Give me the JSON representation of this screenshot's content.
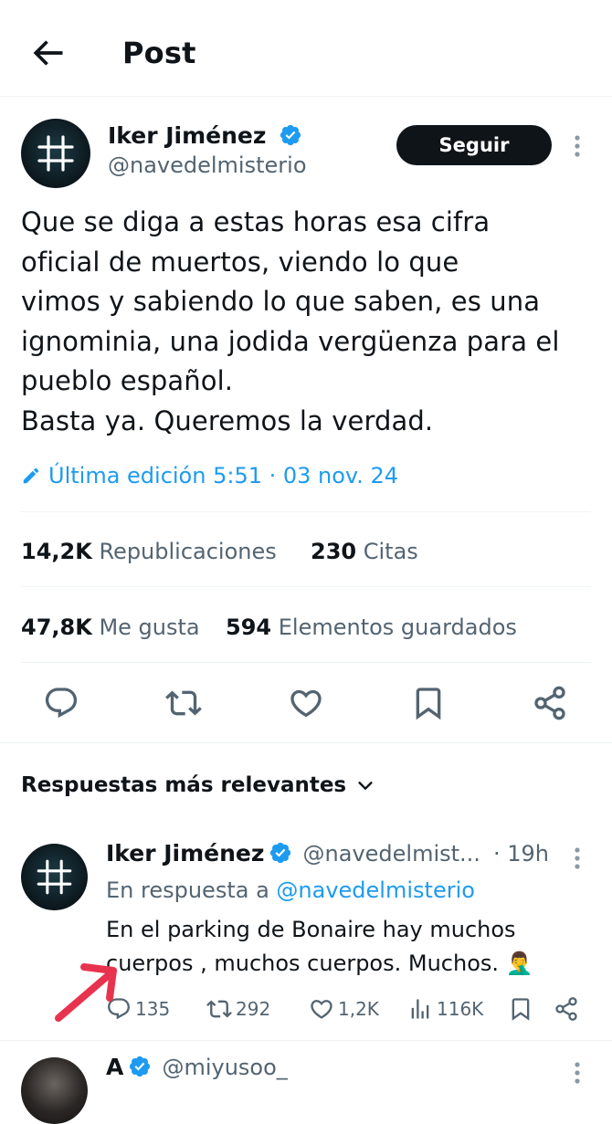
{
  "header": {
    "title": "Post"
  },
  "post": {
    "author_name": "Iker Jiménez",
    "author_handle": "@navedelmisterio",
    "follow_label": "Seguir",
    "text_lines": [
      "Que se diga a estas horas esa cifra",
      "oficial de muertos, viendo lo que",
      "vimos y sabiendo lo que saben, es una",
      "ignominia, una jodida vergüenza para el",
      "pueblo español.",
      "Basta ya. Queremos la verdad."
    ],
    "edited_label": "Última edición 5:51 · 03 nov. 24",
    "stats": {
      "reposts_count": "14,2K",
      "reposts_label": "Republicaciones",
      "quotes_count": "230",
      "quotes_label": "Citas",
      "likes_count": "47,8K",
      "likes_label": "Me gusta",
      "bookmarks_count": "594",
      "bookmarks_label": "Elementos guardados"
    },
    "actions": [
      "reply-icon",
      "repost-icon",
      "like-icon",
      "bookmark-icon",
      "share-icon"
    ]
  },
  "replies_section": {
    "title": "Respuestas más relevantes"
  },
  "reply": {
    "author_name": "Iker Jiménez",
    "author_handle": "@navedelmist...",
    "time": "· 19h",
    "in_reply_prefix": "En respuesta a",
    "in_reply_handle": "@navedelmisterio",
    "text_line1": "En el parking de Bonaire hay muchos",
    "text_line2": "cuerpos , muchos cuerpos. Muchos. 🤦‍♂️",
    "counts": {
      "replies": "135",
      "reposts": "292",
      "likes": "1,2K",
      "views": "116K"
    }
  },
  "reply2": {
    "author_name": "A",
    "author_handle": "@miyusoo_"
  },
  "colors": {
    "accent": "#1d9bf0",
    "text": "#0f1419",
    "muted": "#536471",
    "annotation_arrow": "#e8334e"
  }
}
